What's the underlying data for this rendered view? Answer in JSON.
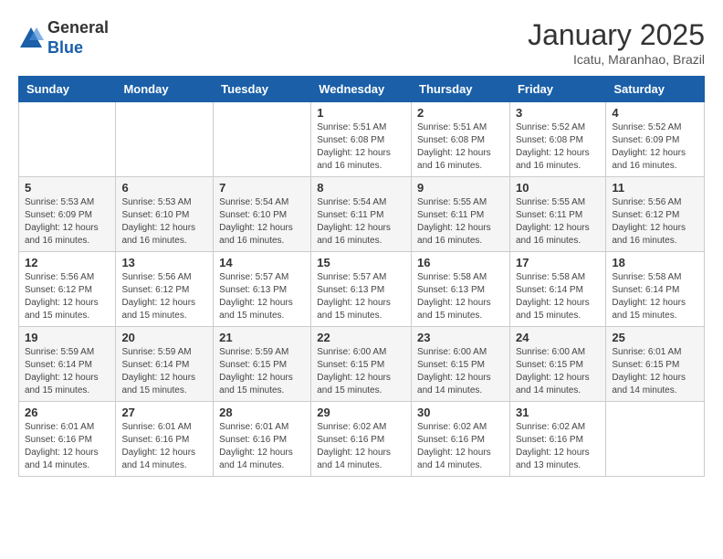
{
  "logo": {
    "general": "General",
    "blue": "Blue"
  },
  "header": {
    "title": "January 2025",
    "subtitle": "Icatu, Maranhao, Brazil"
  },
  "days_of_week": [
    "Sunday",
    "Monday",
    "Tuesday",
    "Wednesday",
    "Thursday",
    "Friday",
    "Saturday"
  ],
  "weeks": [
    [
      {
        "num": "",
        "info": ""
      },
      {
        "num": "",
        "info": ""
      },
      {
        "num": "",
        "info": ""
      },
      {
        "num": "1",
        "info": "Sunrise: 5:51 AM\nSunset: 6:08 PM\nDaylight: 12 hours\nand 16 minutes."
      },
      {
        "num": "2",
        "info": "Sunrise: 5:51 AM\nSunset: 6:08 PM\nDaylight: 12 hours\nand 16 minutes."
      },
      {
        "num": "3",
        "info": "Sunrise: 5:52 AM\nSunset: 6:08 PM\nDaylight: 12 hours\nand 16 minutes."
      },
      {
        "num": "4",
        "info": "Sunrise: 5:52 AM\nSunset: 6:09 PM\nDaylight: 12 hours\nand 16 minutes."
      }
    ],
    [
      {
        "num": "5",
        "info": "Sunrise: 5:53 AM\nSunset: 6:09 PM\nDaylight: 12 hours\nand 16 minutes."
      },
      {
        "num": "6",
        "info": "Sunrise: 5:53 AM\nSunset: 6:10 PM\nDaylight: 12 hours\nand 16 minutes."
      },
      {
        "num": "7",
        "info": "Sunrise: 5:54 AM\nSunset: 6:10 PM\nDaylight: 12 hours\nand 16 minutes."
      },
      {
        "num": "8",
        "info": "Sunrise: 5:54 AM\nSunset: 6:11 PM\nDaylight: 12 hours\nand 16 minutes."
      },
      {
        "num": "9",
        "info": "Sunrise: 5:55 AM\nSunset: 6:11 PM\nDaylight: 12 hours\nand 16 minutes."
      },
      {
        "num": "10",
        "info": "Sunrise: 5:55 AM\nSunset: 6:11 PM\nDaylight: 12 hours\nand 16 minutes."
      },
      {
        "num": "11",
        "info": "Sunrise: 5:56 AM\nSunset: 6:12 PM\nDaylight: 12 hours\nand 16 minutes."
      }
    ],
    [
      {
        "num": "12",
        "info": "Sunrise: 5:56 AM\nSunset: 6:12 PM\nDaylight: 12 hours\nand 15 minutes."
      },
      {
        "num": "13",
        "info": "Sunrise: 5:56 AM\nSunset: 6:12 PM\nDaylight: 12 hours\nand 15 minutes."
      },
      {
        "num": "14",
        "info": "Sunrise: 5:57 AM\nSunset: 6:13 PM\nDaylight: 12 hours\nand 15 minutes."
      },
      {
        "num": "15",
        "info": "Sunrise: 5:57 AM\nSunset: 6:13 PM\nDaylight: 12 hours\nand 15 minutes."
      },
      {
        "num": "16",
        "info": "Sunrise: 5:58 AM\nSunset: 6:13 PM\nDaylight: 12 hours\nand 15 minutes."
      },
      {
        "num": "17",
        "info": "Sunrise: 5:58 AM\nSunset: 6:14 PM\nDaylight: 12 hours\nand 15 minutes."
      },
      {
        "num": "18",
        "info": "Sunrise: 5:58 AM\nSunset: 6:14 PM\nDaylight: 12 hours\nand 15 minutes."
      }
    ],
    [
      {
        "num": "19",
        "info": "Sunrise: 5:59 AM\nSunset: 6:14 PM\nDaylight: 12 hours\nand 15 minutes."
      },
      {
        "num": "20",
        "info": "Sunrise: 5:59 AM\nSunset: 6:14 PM\nDaylight: 12 hours\nand 15 minutes."
      },
      {
        "num": "21",
        "info": "Sunrise: 5:59 AM\nSunset: 6:15 PM\nDaylight: 12 hours\nand 15 minutes."
      },
      {
        "num": "22",
        "info": "Sunrise: 6:00 AM\nSunset: 6:15 PM\nDaylight: 12 hours\nand 15 minutes."
      },
      {
        "num": "23",
        "info": "Sunrise: 6:00 AM\nSunset: 6:15 PM\nDaylight: 12 hours\nand 14 minutes."
      },
      {
        "num": "24",
        "info": "Sunrise: 6:00 AM\nSunset: 6:15 PM\nDaylight: 12 hours\nand 14 minutes."
      },
      {
        "num": "25",
        "info": "Sunrise: 6:01 AM\nSunset: 6:15 PM\nDaylight: 12 hours\nand 14 minutes."
      }
    ],
    [
      {
        "num": "26",
        "info": "Sunrise: 6:01 AM\nSunset: 6:16 PM\nDaylight: 12 hours\nand 14 minutes."
      },
      {
        "num": "27",
        "info": "Sunrise: 6:01 AM\nSunset: 6:16 PM\nDaylight: 12 hours\nand 14 minutes."
      },
      {
        "num": "28",
        "info": "Sunrise: 6:01 AM\nSunset: 6:16 PM\nDaylight: 12 hours\nand 14 minutes."
      },
      {
        "num": "29",
        "info": "Sunrise: 6:02 AM\nSunset: 6:16 PM\nDaylight: 12 hours\nand 14 minutes."
      },
      {
        "num": "30",
        "info": "Sunrise: 6:02 AM\nSunset: 6:16 PM\nDaylight: 12 hours\nand 14 minutes."
      },
      {
        "num": "31",
        "info": "Sunrise: 6:02 AM\nSunset: 6:16 PM\nDaylight: 12 hours\nand 13 minutes."
      },
      {
        "num": "",
        "info": ""
      }
    ]
  ]
}
